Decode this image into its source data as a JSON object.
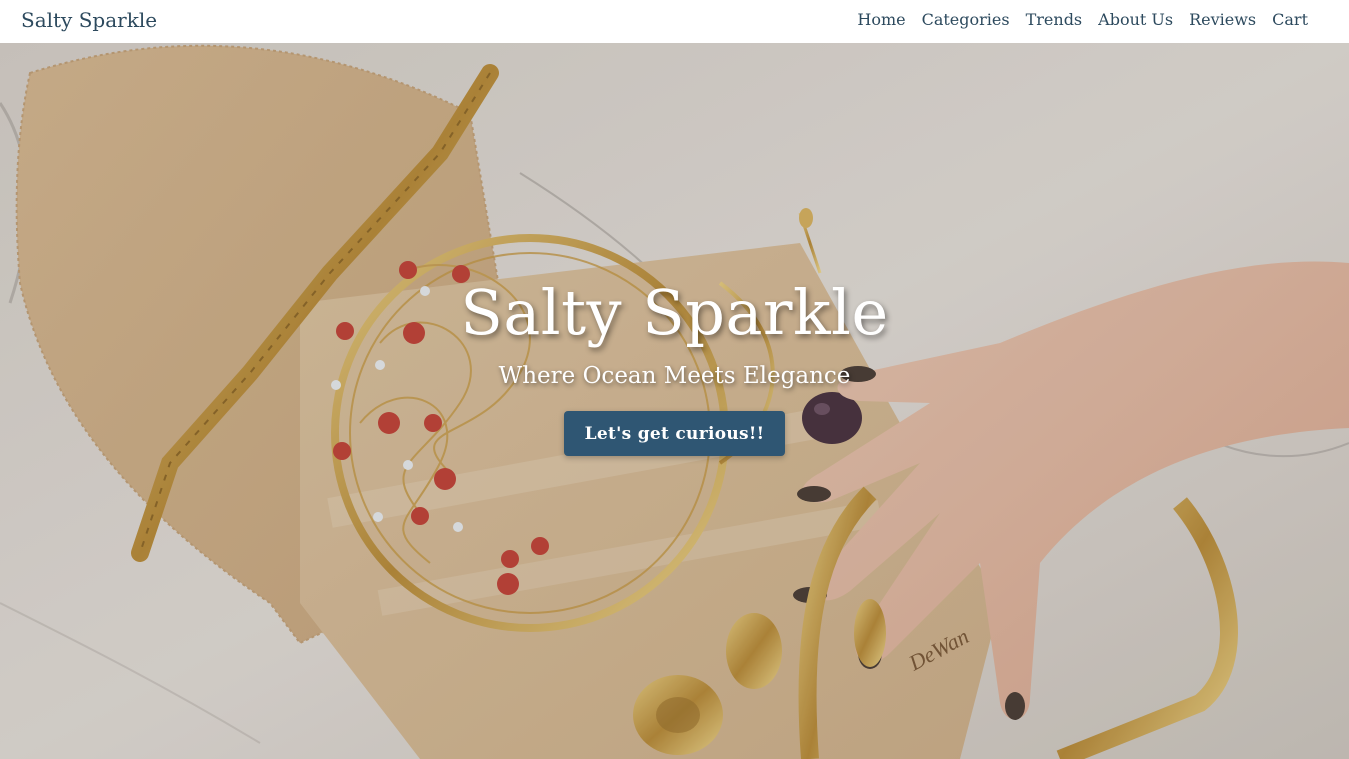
{
  "nav": {
    "brand": "Salty Sparkle",
    "links": [
      "Home",
      "Categories",
      "Trends",
      "About Us",
      "Reviews",
      "Cart"
    ]
  },
  "hero": {
    "title": "Salty Sparkle",
    "subtitle": "Where Ocean Meets Elegance",
    "cta": "Let's get curious!!",
    "photo_watermark": "DeWan"
  },
  "colors": {
    "nav_text": "#2d4a5e",
    "cta_background": "#2f5673",
    "hero_text": "#ffffff"
  }
}
